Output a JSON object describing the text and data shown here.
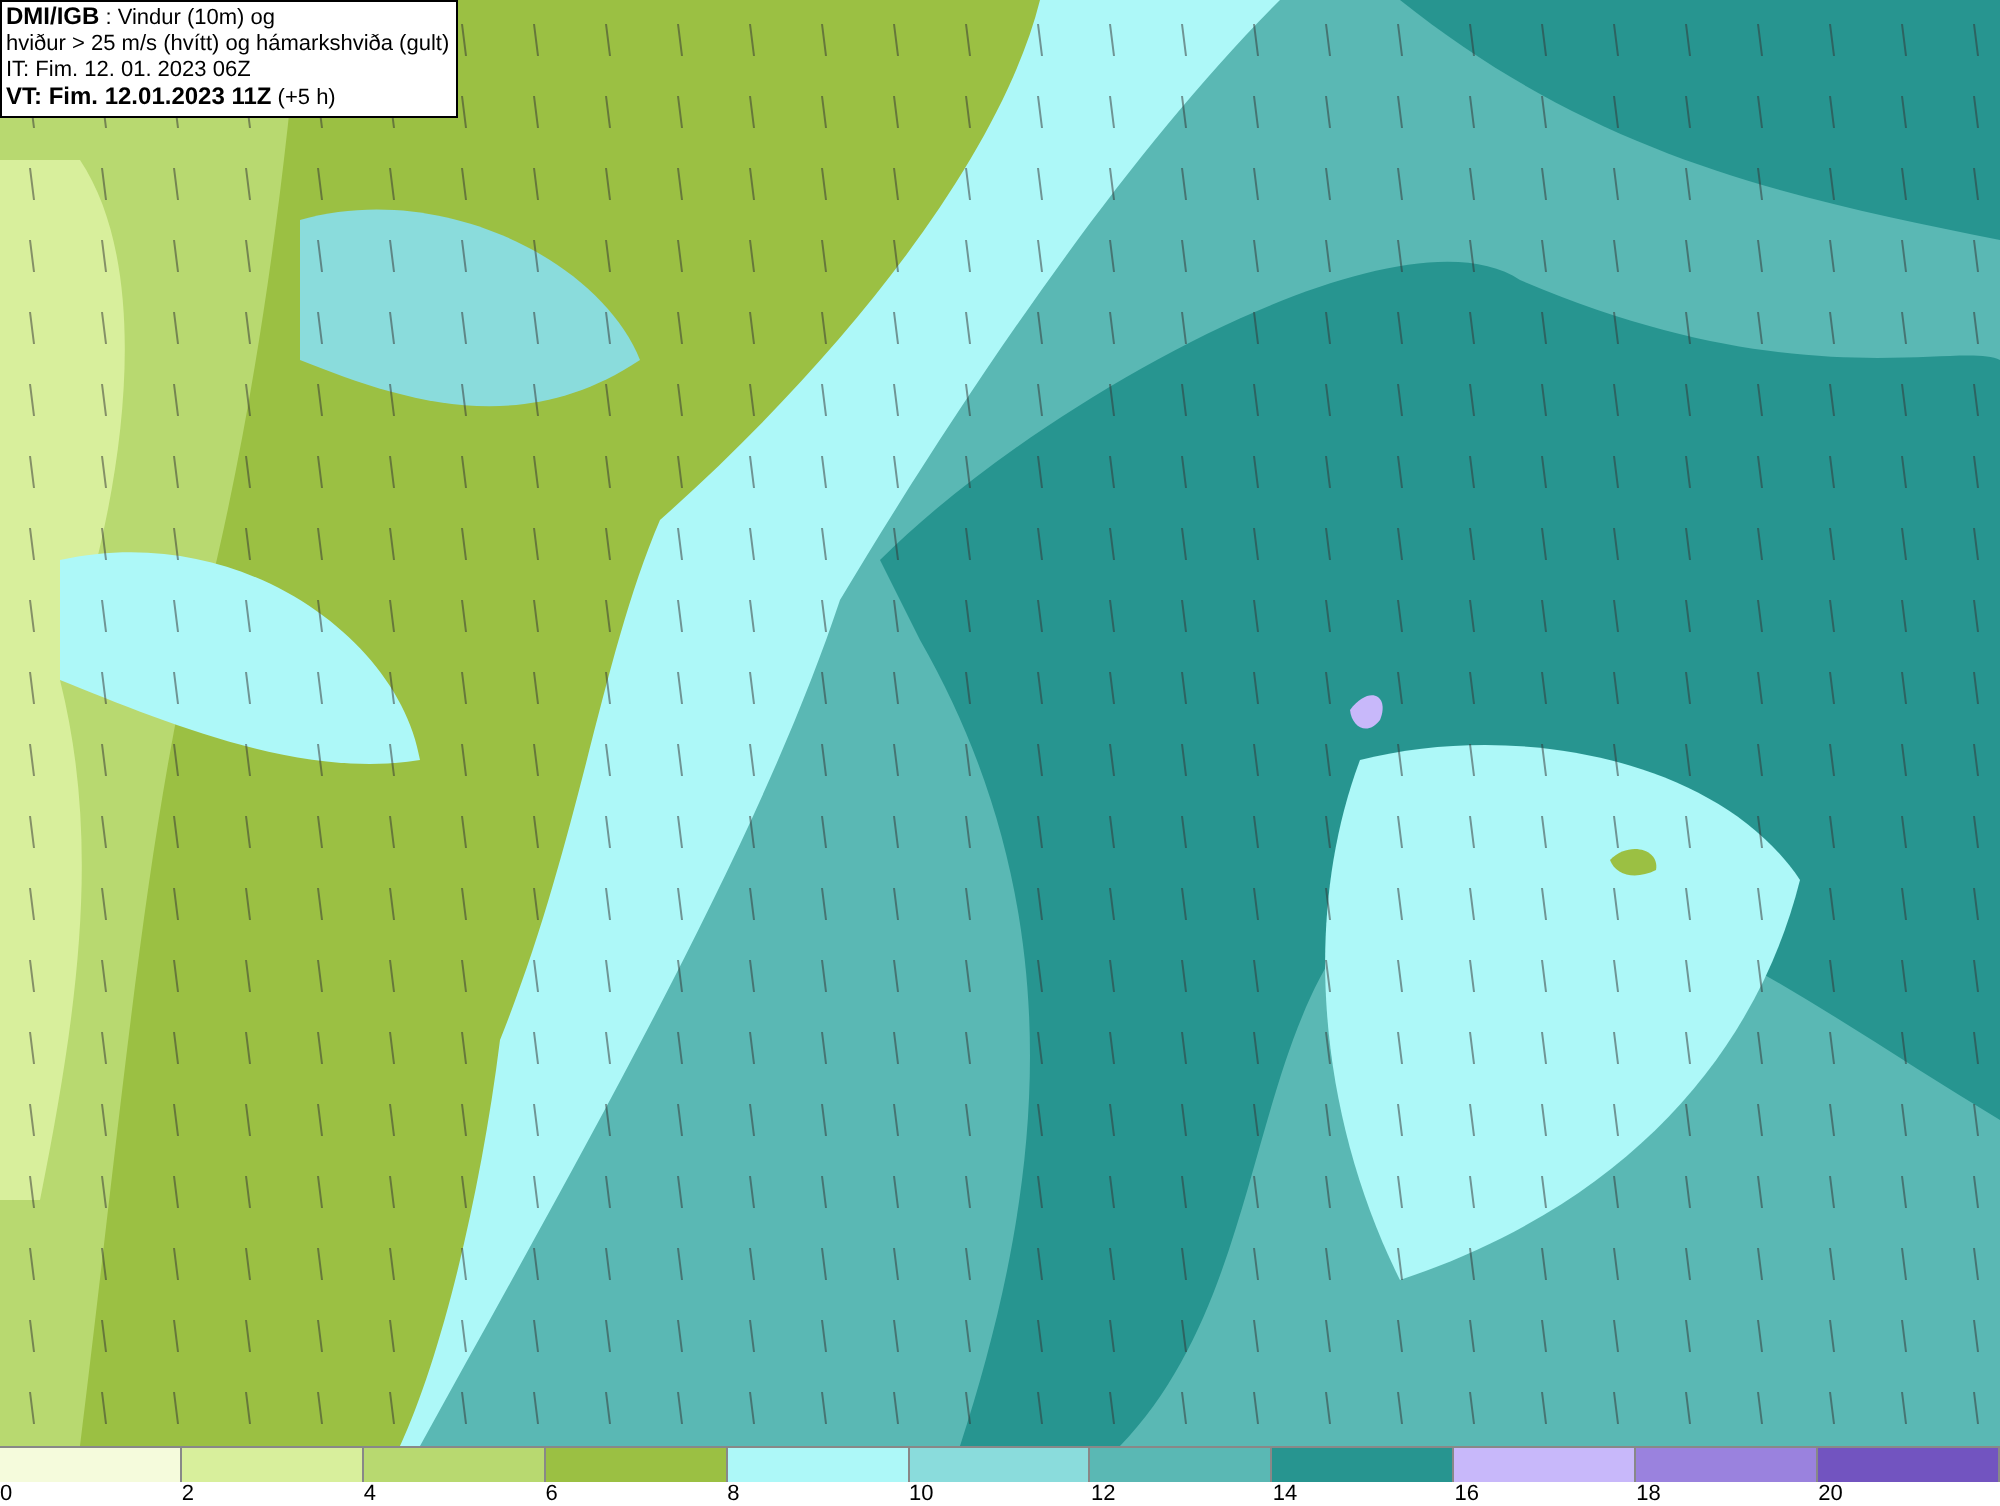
{
  "title_box": {
    "lines": [
      "**DMI/IGB** : Vindur (10m) og",
      "hviður > 25 m/s (hvítt) og hámarkshviða (gult)",
      "IT: Fim. 12. 01. 2023 06Z",
      "**VT: Fim. 12.01.2023 11Z** (+5 h)"
    ]
  },
  "legend": {
    "bins": [
      {
        "label": "0",
        "color": "#f5fbdc"
      },
      {
        "label": "2",
        "color": "#d8ef9c"
      },
      {
        "label": "4",
        "color": "#b8d970"
      },
      {
        "label": "6",
        "color": "#9bc043"
      },
      {
        "label": "8",
        "color": "#adf8f8"
      },
      {
        "label": "10",
        "color": "#8adcdc"
      },
      {
        "label": "12",
        "color": "#5ab8b4"
      },
      {
        "label": "14",
        "color": "#279590"
      },
      {
        "label": "16",
        "color": "#c8b8fa"
      },
      {
        "label": "18",
        "color": "#9a82de"
      },
      {
        "label": "20",
        "color": "#7254c0"
      }
    ]
  }
}
